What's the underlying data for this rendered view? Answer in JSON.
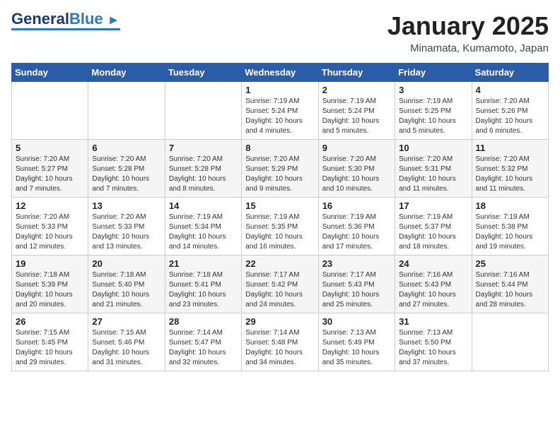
{
  "header": {
    "logo_line1": "General",
    "logo_line2": "Blue",
    "month_title": "January 2025",
    "location": "Minamata, Kumamoto, Japan"
  },
  "weekdays": [
    "Sunday",
    "Monday",
    "Tuesday",
    "Wednesday",
    "Thursday",
    "Friday",
    "Saturday"
  ],
  "weeks": [
    [
      {
        "day": "",
        "text": ""
      },
      {
        "day": "",
        "text": ""
      },
      {
        "day": "",
        "text": ""
      },
      {
        "day": "1",
        "text": "Sunrise: 7:19 AM\nSunset: 5:24 PM\nDaylight: 10 hours and 4 minutes."
      },
      {
        "day": "2",
        "text": "Sunrise: 7:19 AM\nSunset: 5:24 PM\nDaylight: 10 hours and 5 minutes."
      },
      {
        "day": "3",
        "text": "Sunrise: 7:19 AM\nSunset: 5:25 PM\nDaylight: 10 hours and 5 minutes."
      },
      {
        "day": "4",
        "text": "Sunrise: 7:20 AM\nSunset: 5:26 PM\nDaylight: 10 hours and 6 minutes."
      }
    ],
    [
      {
        "day": "5",
        "text": "Sunrise: 7:20 AM\nSunset: 5:27 PM\nDaylight: 10 hours and 7 minutes."
      },
      {
        "day": "6",
        "text": "Sunrise: 7:20 AM\nSunset: 5:28 PM\nDaylight: 10 hours and 7 minutes."
      },
      {
        "day": "7",
        "text": "Sunrise: 7:20 AM\nSunset: 5:28 PM\nDaylight: 10 hours and 8 minutes."
      },
      {
        "day": "8",
        "text": "Sunrise: 7:20 AM\nSunset: 5:29 PM\nDaylight: 10 hours and 9 minutes."
      },
      {
        "day": "9",
        "text": "Sunrise: 7:20 AM\nSunset: 5:30 PM\nDaylight: 10 hours and 10 minutes."
      },
      {
        "day": "10",
        "text": "Sunrise: 7:20 AM\nSunset: 5:31 PM\nDaylight: 10 hours and 11 minutes."
      },
      {
        "day": "11",
        "text": "Sunrise: 7:20 AM\nSunset: 5:32 PM\nDaylight: 10 hours and 11 minutes."
      }
    ],
    [
      {
        "day": "12",
        "text": "Sunrise: 7:20 AM\nSunset: 5:33 PM\nDaylight: 10 hours and 12 minutes."
      },
      {
        "day": "13",
        "text": "Sunrise: 7:20 AM\nSunset: 5:33 PM\nDaylight: 10 hours and 13 minutes."
      },
      {
        "day": "14",
        "text": "Sunrise: 7:19 AM\nSunset: 5:34 PM\nDaylight: 10 hours and 14 minutes."
      },
      {
        "day": "15",
        "text": "Sunrise: 7:19 AM\nSunset: 5:35 PM\nDaylight: 10 hours and 16 minutes."
      },
      {
        "day": "16",
        "text": "Sunrise: 7:19 AM\nSunset: 5:36 PM\nDaylight: 10 hours and 17 minutes."
      },
      {
        "day": "17",
        "text": "Sunrise: 7:19 AM\nSunset: 5:37 PM\nDaylight: 10 hours and 18 minutes."
      },
      {
        "day": "18",
        "text": "Sunrise: 7:19 AM\nSunset: 5:38 PM\nDaylight: 10 hours and 19 minutes."
      }
    ],
    [
      {
        "day": "19",
        "text": "Sunrise: 7:18 AM\nSunset: 5:39 PM\nDaylight: 10 hours and 20 minutes."
      },
      {
        "day": "20",
        "text": "Sunrise: 7:18 AM\nSunset: 5:40 PM\nDaylight: 10 hours and 21 minutes."
      },
      {
        "day": "21",
        "text": "Sunrise: 7:18 AM\nSunset: 5:41 PM\nDaylight: 10 hours and 23 minutes."
      },
      {
        "day": "22",
        "text": "Sunrise: 7:17 AM\nSunset: 5:42 PM\nDaylight: 10 hours and 24 minutes."
      },
      {
        "day": "23",
        "text": "Sunrise: 7:17 AM\nSunset: 5:43 PM\nDaylight: 10 hours and 25 minutes."
      },
      {
        "day": "24",
        "text": "Sunrise: 7:16 AM\nSunset: 5:43 PM\nDaylight: 10 hours and 27 minutes."
      },
      {
        "day": "25",
        "text": "Sunrise: 7:16 AM\nSunset: 5:44 PM\nDaylight: 10 hours and 28 minutes."
      }
    ],
    [
      {
        "day": "26",
        "text": "Sunrise: 7:15 AM\nSunset: 5:45 PM\nDaylight: 10 hours and 29 minutes."
      },
      {
        "day": "27",
        "text": "Sunrise: 7:15 AM\nSunset: 5:46 PM\nDaylight: 10 hours and 31 minutes."
      },
      {
        "day": "28",
        "text": "Sunrise: 7:14 AM\nSunset: 5:47 PM\nDaylight: 10 hours and 32 minutes."
      },
      {
        "day": "29",
        "text": "Sunrise: 7:14 AM\nSunset: 5:48 PM\nDaylight: 10 hours and 34 minutes."
      },
      {
        "day": "30",
        "text": "Sunrise: 7:13 AM\nSunset: 5:49 PM\nDaylight: 10 hours and 35 minutes."
      },
      {
        "day": "31",
        "text": "Sunrise: 7:13 AM\nSunset: 5:50 PM\nDaylight: 10 hours and 37 minutes."
      },
      {
        "day": "",
        "text": ""
      }
    ]
  ]
}
